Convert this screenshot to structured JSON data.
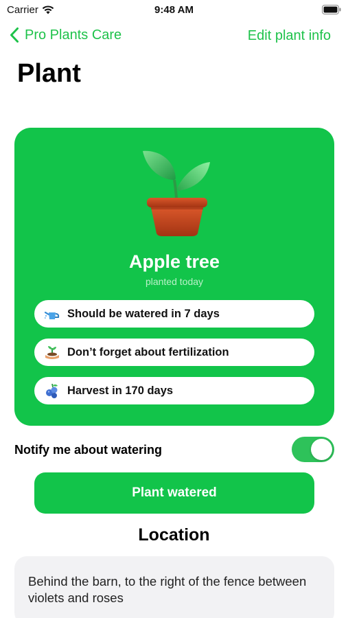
{
  "status_bar": {
    "carrier": "Carrier",
    "time": "9:48 AM"
  },
  "nav": {
    "back_label": "Pro Plants Care",
    "edit_label": "Edit plant info"
  },
  "page": {
    "title": "Plant"
  },
  "plant_card": {
    "name": "Apple tree",
    "subtitle": "planted today",
    "background_color": "#12c44a",
    "reminders": [
      {
        "icon": "watering-can-icon",
        "text": "Should be watered in 7 days"
      },
      {
        "icon": "seedling-hand-icon",
        "text": "Don’t forget about fertilization"
      },
      {
        "icon": "berries-icon",
        "text": "Harvest in 170 days"
      }
    ]
  },
  "notify": {
    "label": "Notify me about watering",
    "enabled": true
  },
  "actions": {
    "primary_label": "Plant watered"
  },
  "location": {
    "title": "Location",
    "text": "Behind the barn, to the right of the fence between violets and roses"
  },
  "colors": {
    "accent": "#1ec24a",
    "card": "#12c44a",
    "toggle_on": "#2ec25a",
    "location_bg": "#f2f2f4"
  }
}
